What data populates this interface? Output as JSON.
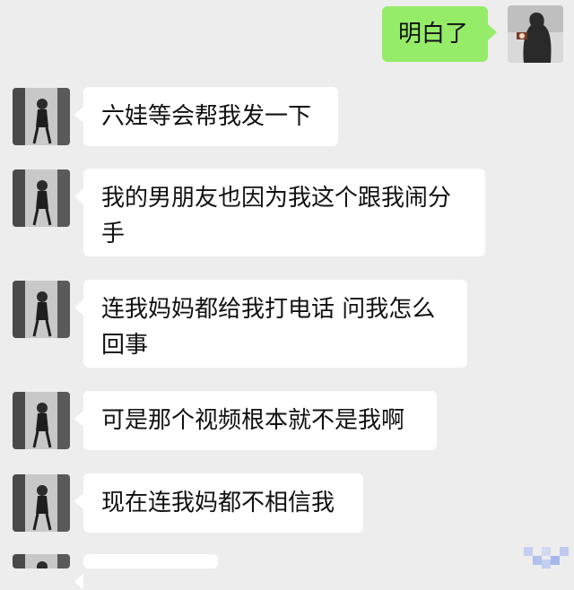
{
  "messages": [
    {
      "side": "right",
      "text": "明白了",
      "avatar": "contact-avatar"
    },
    {
      "side": "left",
      "text": "六娃等会帮我发一下",
      "avatar": "girl-avatar"
    },
    {
      "side": "left",
      "text": "我的男朋友也因为我这个跟我闹分手",
      "avatar": "girl-avatar"
    },
    {
      "side": "left",
      "text": "连我妈妈都给我打电话 问我怎么回事",
      "avatar": "girl-avatar"
    },
    {
      "side": "left",
      "text": "可是那个视频根本就不是我啊",
      "avatar": "girl-avatar"
    },
    {
      "side": "left",
      "text": "现在连我妈都不相信我",
      "avatar": "girl-avatar"
    }
  ],
  "colors": {
    "background": "#ededed",
    "incoming_bubble": "#ffffff",
    "outgoing_bubble": "#95ec69"
  }
}
